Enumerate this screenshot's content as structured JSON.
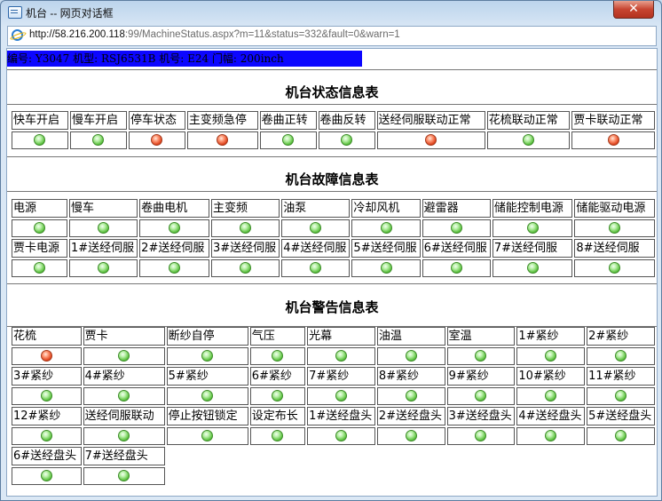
{
  "window": {
    "title": "机台 -- 网页对话框",
    "close_label": "✕"
  },
  "address": {
    "host": "http://58.216.200.118",
    "rest": ":99/MachineStatus.aspx?m=11&status=332&fault=0&warn=1"
  },
  "info_bar": "编号:  Y3047  机型:  RSJ6531B  机号:  E24  门幅:  200inch",
  "status": {
    "title": "机台状态信息表",
    "labels": [
      "快车开启",
      "慢车开启",
      "停车状态",
      "主变频急停",
      "卷曲正转",
      "卷曲反转",
      "送经伺服联动正常",
      "花梳联动正常",
      "贾卡联动正常"
    ],
    "leds": [
      "green",
      "green",
      "red",
      "red",
      "green",
      "green",
      "red",
      "green",
      "red"
    ]
  },
  "fault": {
    "title": "机台故障信息表",
    "row1_labels": [
      "电源",
      "慢车",
      "卷曲电机",
      "主变频",
      "油泵",
      "冷却风机",
      "避雷器",
      "储能控制电源",
      "储能驱动电源"
    ],
    "row1_leds": [
      "green",
      "green",
      "green",
      "green",
      "green",
      "green",
      "green",
      "green",
      "green"
    ],
    "row2_labels": [
      "贾卡电源",
      "1#送经伺服",
      "2#送经伺服",
      "3#送经伺服",
      "4#送经伺服",
      "5#送经伺服",
      "6#送经伺服",
      "7#送经伺服",
      "8#送经伺服"
    ],
    "row2_leds": [
      "green",
      "green",
      "green",
      "green",
      "green",
      "green",
      "green",
      "green",
      "green"
    ]
  },
  "warn": {
    "title": "机台警告信息表",
    "row1_labels": [
      "花梳",
      "贾卡",
      "断纱自停",
      "气压",
      "光幕",
      "油温",
      "室温",
      "1#紧纱",
      "2#紧纱"
    ],
    "row1_leds": [
      "red",
      "green",
      "green",
      "green",
      "green",
      "green",
      "green",
      "green",
      "green"
    ],
    "row2_labels": [
      "3#紧纱",
      "4#紧纱",
      "5#紧纱",
      "6#紧纱",
      "7#紧纱",
      "8#紧纱",
      "9#紧纱",
      "10#紧纱",
      "11#紧纱"
    ],
    "row2_leds": [
      "green",
      "green",
      "green",
      "green",
      "green",
      "green",
      "green",
      "green",
      "green"
    ],
    "row3_labels": [
      "12#紧纱",
      "送经伺服联动",
      "停止按钮锁定",
      "设定布长",
      "1#送经盘头",
      "2#送经盘头",
      "3#送经盘头",
      "4#送经盘头",
      "5#送经盘头"
    ],
    "row3_leds": [
      "green",
      "green",
      "green",
      "green",
      "green",
      "green",
      "green",
      "green",
      "green"
    ],
    "row4_labels": [
      "6#送经盘头",
      "7#送经盘头"
    ],
    "row4_leds": [
      "green",
      "green"
    ]
  },
  "colors": {
    "ok": "#5cc23f",
    "alarm": "#e0441e",
    "info_bg": "#0c06ff"
  }
}
